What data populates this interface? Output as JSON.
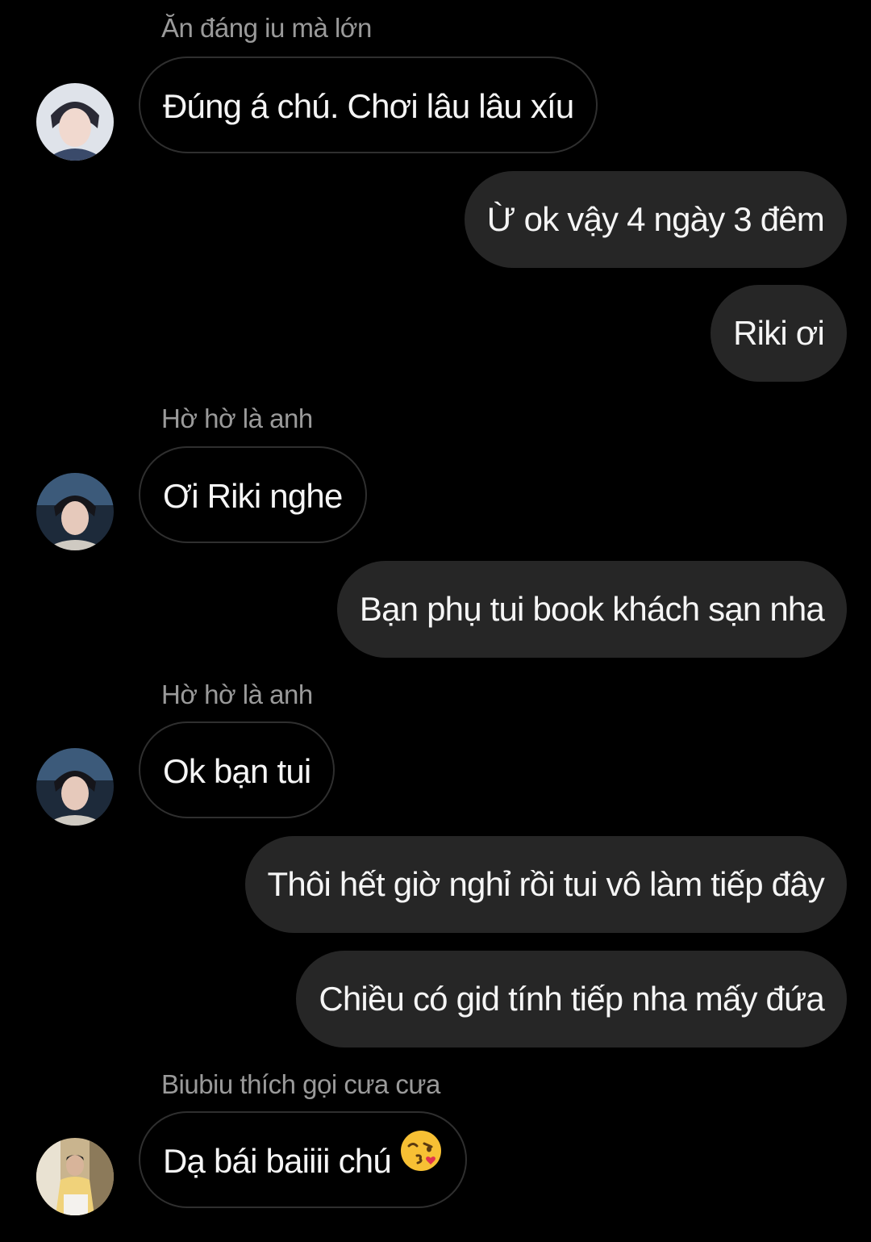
{
  "messages": [
    {
      "sender": "Ăn đáng iu mà lớn",
      "text": "Đúng á chú. Chơi lâu lâu xíu"
    },
    {
      "text": "Ừ ok vậy 4 ngày 3 đêm"
    },
    {
      "text": "Riki ơi"
    },
    {
      "sender": "Hờ hờ là anh",
      "text": "Ơi Riki nghe"
    },
    {
      "text": "Bạn phụ tui book khách sạn nha"
    },
    {
      "sender": "Hờ hờ là anh",
      "text": "Ok bạn tui"
    },
    {
      "text": "Thôi hết giờ nghỉ rồi tui vô làm tiếp đây"
    },
    {
      "text": "Chiều có gid tính tiếp nha mấy đứa"
    },
    {
      "sender": "Biubiu thích gọi cưa cưa",
      "text": "Dạ bái baiiii chú",
      "emoji": "kissing-face-emoji"
    }
  ],
  "colors": {
    "background": "#000000",
    "outgoing_bubble": "#262626",
    "incoming_border": "#2f2f2f",
    "sender_name": "#9a9a9a",
    "text": "#f5f5f5"
  }
}
